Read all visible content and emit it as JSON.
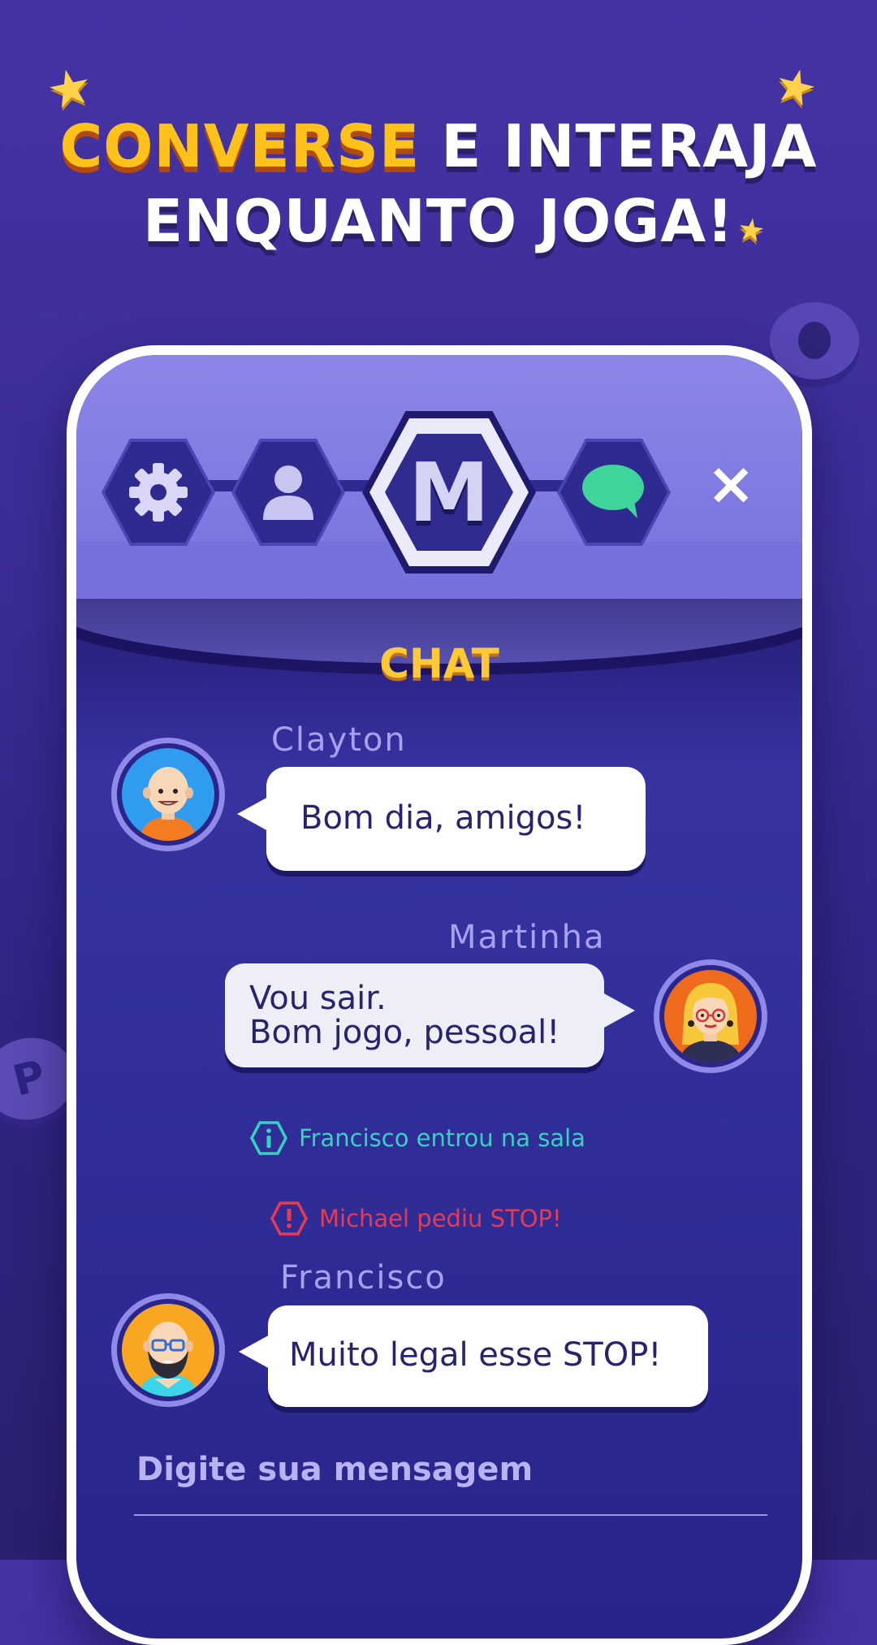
{
  "promo": {
    "headline_highlight": "CONVERSE",
    "headline_rest": " E INTERAJA",
    "headline_line2": "ENQUANTO JOGA!",
    "decor_letter_p": "P"
  },
  "toolbar": {
    "settings_icon": "gear-icon",
    "profile_icon": "user-icon",
    "logo_letter": "M",
    "chat_icon": "speech-bubble-icon",
    "close_label": "×"
  },
  "chat": {
    "title": "CHAT",
    "messages": [
      {
        "sender": "Clayton",
        "text": "Bom dia, amigos!",
        "side": "left"
      },
      {
        "sender": "Martinha",
        "text_line1": "Vou sair.",
        "text_line2": "Bom jogo, pessoal!",
        "side": "right"
      },
      {
        "sender": "Francisco",
        "text": "Muito legal esse STOP!",
        "side": "left"
      }
    ],
    "notices": [
      {
        "text": "Francisco entrou na sala",
        "icon": "info-hexagon-icon"
      },
      {
        "text": "Michael pediu STOP!",
        "icon": "alert-hexagon-icon"
      }
    ],
    "input_placeholder": "Digite sua mensagem"
  },
  "colors": {
    "background": "#3a2d95",
    "accent_yellow": "#ffc21a",
    "notice_info": "#35d2c0",
    "notice_alert": "#e63b52",
    "sender_name": "#a8a2ee",
    "chat_icon_green": "#3fd49a"
  }
}
